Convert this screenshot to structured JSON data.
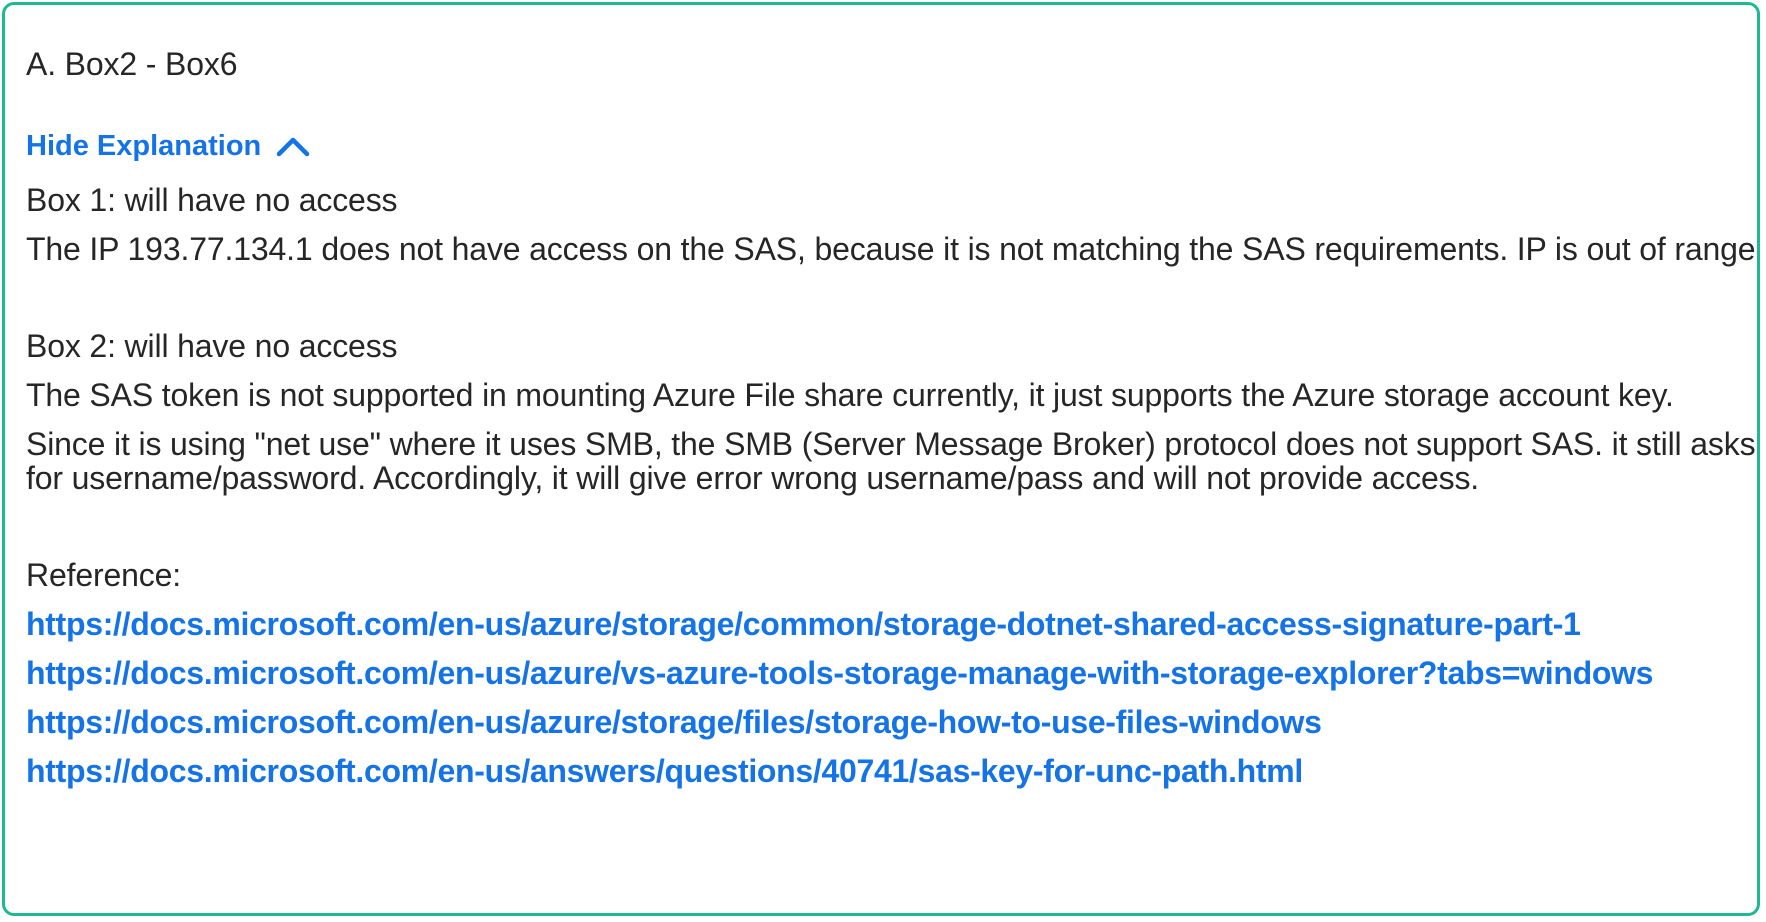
{
  "answer": {
    "text": "A. Box2 - Box6"
  },
  "explanation_toggle": {
    "label": "Hide Explanation",
    "icon": "chevron-up-icon",
    "color": "#1473e6"
  },
  "explanation": {
    "box1": {
      "heading": "Box 1: will have no access",
      "body": "The IP 193.77.134.1 does not have access on the SAS, because it is not matching the SAS requirements. IP is out of range."
    },
    "box2": {
      "heading": "Box 2: will have no access",
      "body1": "The SAS token is not supported in mounting Azure File share currently, it just supports the Azure storage account key.",
      "body2_line1": "Since it is using \"net use\" where it uses SMB, the SMB (Server Message Broker) protocol does not support SAS. it still asks",
      "body2_line2": "for username/password. Accordingly, it will give error wrong username/pass and will not provide access."
    },
    "reference_label": "Reference:",
    "references": [
      "https://docs.microsoft.com/en-us/azure/storage/common/storage-dotnet-shared-access-signature-part-1",
      "https://docs.microsoft.com/en-us/azure/vs-azure-tools-storage-manage-with-storage-explorer?tabs=windows",
      "https://docs.microsoft.com/en-us/azure/storage/files/storage-how-to-use-files-windows",
      "https://docs.microsoft.com/en-us/answers/questions/40741/sas-key-for-unc-path.html"
    ]
  },
  "colors": {
    "border": "#1fb894",
    "link": "#1473e6",
    "text": "#262626"
  }
}
